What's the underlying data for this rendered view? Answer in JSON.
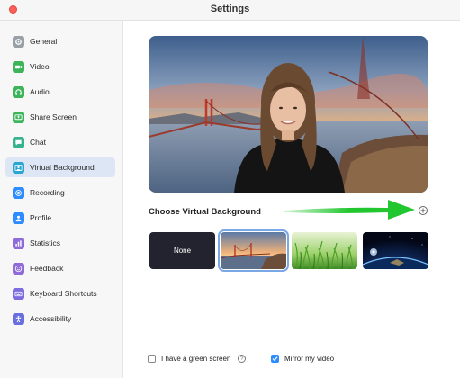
{
  "window": {
    "title": "Settings"
  },
  "sidebar": {
    "items": [
      {
        "label": "General",
        "icon": "gear-icon",
        "color": "#9aa0a8"
      },
      {
        "label": "Video",
        "icon": "video-camera-icon",
        "color": "#3db35a"
      },
      {
        "label": "Audio",
        "icon": "headphones-icon",
        "color": "#3db35a"
      },
      {
        "label": "Share Screen",
        "icon": "share-screen-icon",
        "color": "#3db35a"
      },
      {
        "label": "Chat",
        "icon": "chat-bubble-icon",
        "color": "#34b38e"
      },
      {
        "label": "Virtual Background",
        "icon": "person-background-icon",
        "color": "#2aa6d0",
        "active": true
      },
      {
        "label": "Recording",
        "icon": "record-icon",
        "color": "#2d8cff"
      },
      {
        "label": "Profile",
        "icon": "profile-icon",
        "color": "#2d8cff"
      },
      {
        "label": "Statistics",
        "icon": "statistics-icon",
        "color": "#8e6bd8"
      },
      {
        "label": "Feedback",
        "icon": "feedback-smile-icon",
        "color": "#8e6bd8"
      },
      {
        "label": "Keyboard Shortcuts",
        "icon": "keyboard-icon",
        "color": "#7d6be0"
      },
      {
        "label": "Accessibility",
        "icon": "accessibility-icon",
        "color": "#6a6fe0"
      }
    ]
  },
  "main": {
    "section_title": "Choose Virtual Background",
    "add_icon": "plus-circle-icon",
    "thumbnails": [
      {
        "label": "None",
        "selected": false
      },
      {
        "label": "",
        "scene": "golden-gate-bridge",
        "selected": true
      },
      {
        "label": "",
        "scene": "grass",
        "selected": false
      },
      {
        "label": "",
        "scene": "earth-from-space",
        "selected": false
      }
    ],
    "green_screen_label": "I have a green screen",
    "green_screen_checked": false,
    "mirror_label": "Mirror my video",
    "mirror_checked": true,
    "accent_color": "#2d8cff",
    "arrow_color": "#22c72f"
  }
}
